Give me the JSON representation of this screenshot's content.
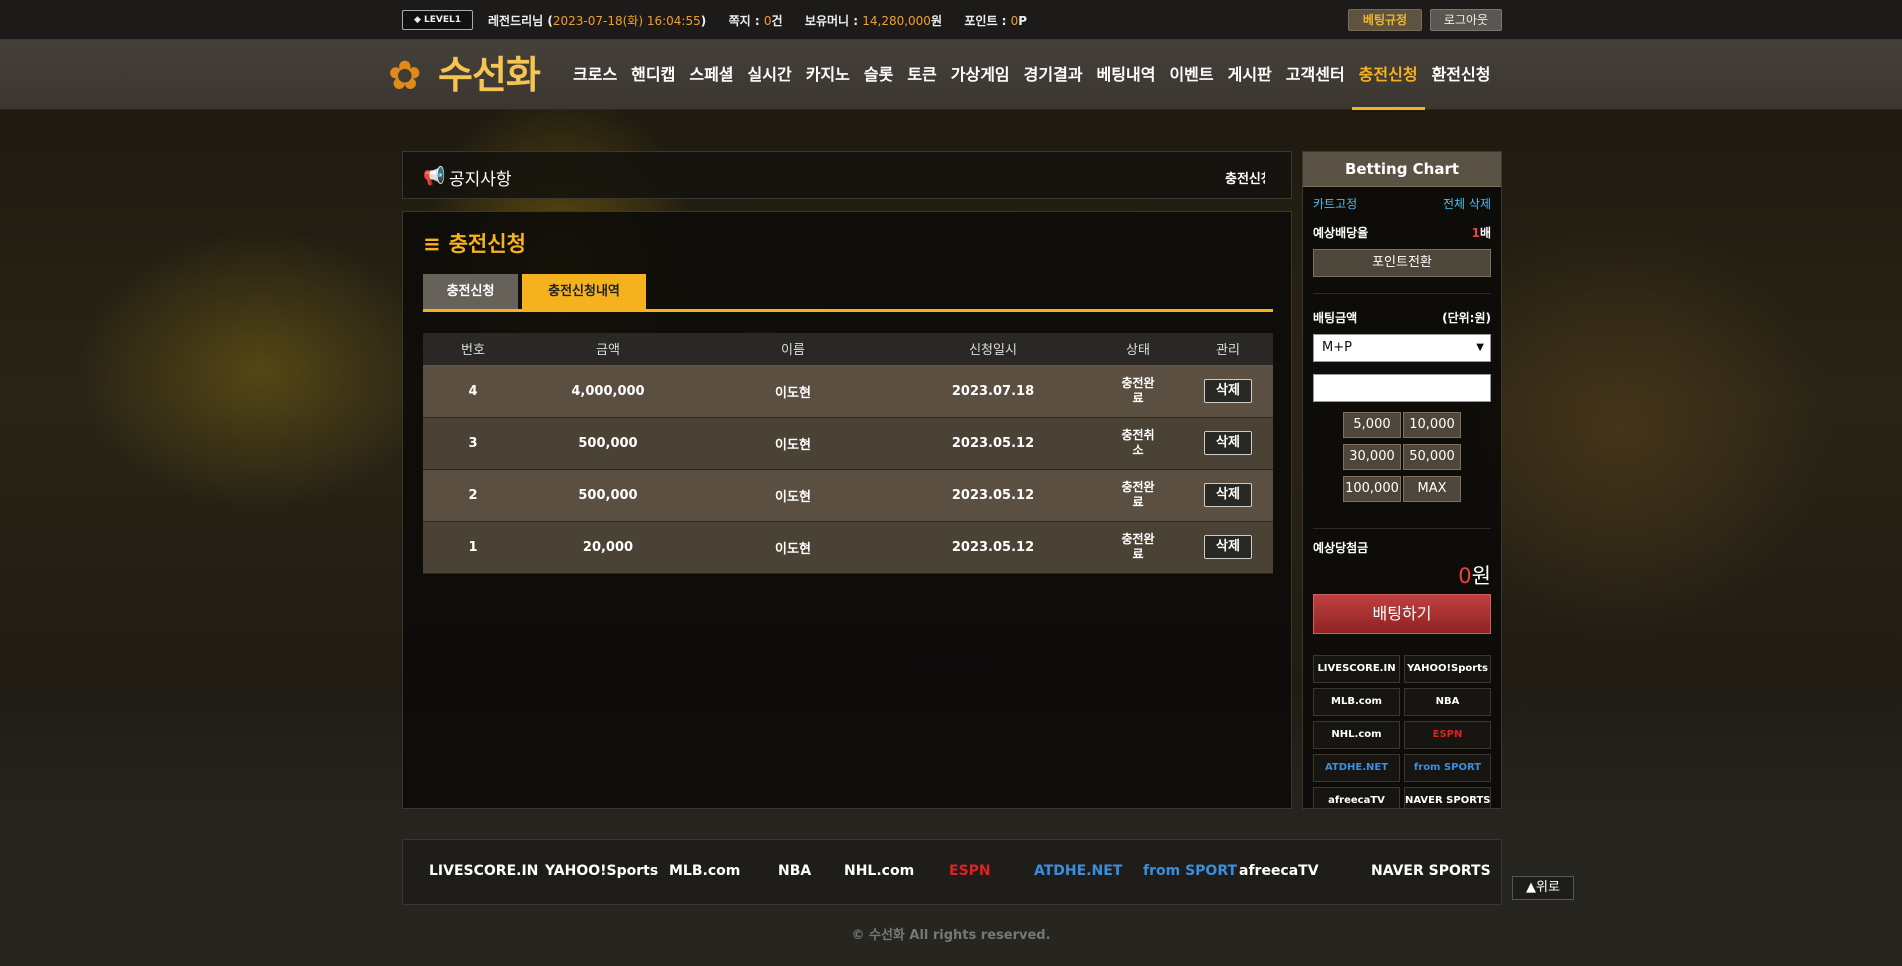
{
  "header": {
    "level_badge": "LEVEL1",
    "user_name": "레전드리님 (",
    "datetime": "2023-07-18(화) 16:04:55",
    "datetime_close": ")",
    "note_label": "쪽지 : ",
    "note_count": "0",
    "note_unit": "건",
    "bonus_label": "보유머니 : ",
    "bonus_value": "14,280,000",
    "bonus_unit": "원",
    "point_label": "포인트 : ",
    "point_value": "0",
    "point_unit": "P",
    "rules_button": "베팅규정",
    "logout_button": "로그아웃"
  },
  "nav": {
    "logo_text": "수선화",
    "items": [
      "크로스",
      "핸디캡",
      "스페셜",
      "실시간",
      "카지노",
      "슬롯",
      "토큰",
      "가상게임",
      "경기결과",
      "베팅내역",
      "이벤트",
      "게시판",
      "고객센터",
      "충전신청",
      "환전신청"
    ],
    "active_index": 13
  },
  "notice": {
    "title": "공지사항",
    "ticker": "충전신청"
  },
  "main": {
    "title": "충전신청",
    "tabs": [
      "충전신청",
      "충전신청내역"
    ],
    "table": {
      "headers": [
        "번호",
        "금액",
        "이름",
        "신청일시",
        "상태",
        "관리"
      ],
      "rows": [
        {
          "no": "4",
          "amount": "4,000,000",
          "name": "이도현",
          "date": "2023.07.18",
          "status": "충전완료",
          "action": "삭제"
        },
        {
          "no": "3",
          "amount": "500,000",
          "name": "이도현",
          "date": "2023.05.12",
          "status": "충전취소",
          "action": "삭제"
        },
        {
          "no": "2",
          "amount": "500,000",
          "name": "이도현",
          "date": "2023.05.12",
          "status": "충전완료",
          "action": "삭제"
        },
        {
          "no": "1",
          "amount": "20,000",
          "name": "이도현",
          "date": "2023.05.12",
          "status": "충전완료",
          "action": "삭제"
        }
      ]
    }
  },
  "bet_chart": {
    "title": "Betting Chart",
    "cart_fix": "카트고정",
    "clear_all": "전체 삭제",
    "expected_odds_label": "예상배당율",
    "expected_odds_value": "1",
    "expected_odds_unit": "배",
    "point_convert": "포인트전환",
    "bet_amount_label": "배팅금액",
    "unit_label": "(단위:원)",
    "select_value": "M+P",
    "chips": [
      "5,000",
      "10,000",
      "30,000",
      "50,000",
      "100,000",
      "MAX"
    ],
    "expected_win_label": "예상당첨금",
    "expected_win_value": "0",
    "expected_win_unit": "원",
    "bet_button": "배팅하기",
    "partner_logos": [
      "LIVESCORE.IN",
      "YAHOO!Sports",
      "MLB.com",
      "NBA",
      "NHL.com",
      "ESPN",
      "ATDHE.NET",
      "from SPORT",
      "afreecaTV",
      "NAVER SPORTS"
    ]
  },
  "footer": {
    "logos": [
      "LIVESCORE.IN",
      "YAHOO!Sports",
      "MLB.com",
      "NBA",
      "NHL.com",
      "ESPN",
      "ATDHE.NET",
      "from SPORT",
      "afreecaTV",
      "NAVER SPORTS"
    ],
    "top_button": "▲위로",
    "copyright": "© 수선화 All rights reserved."
  },
  "colors": {
    "accent": "#f5b21e",
    "highlight_orange": "#f0a030",
    "bet_button_red": "#a83030",
    "link_cyan": "#58b8e8"
  }
}
